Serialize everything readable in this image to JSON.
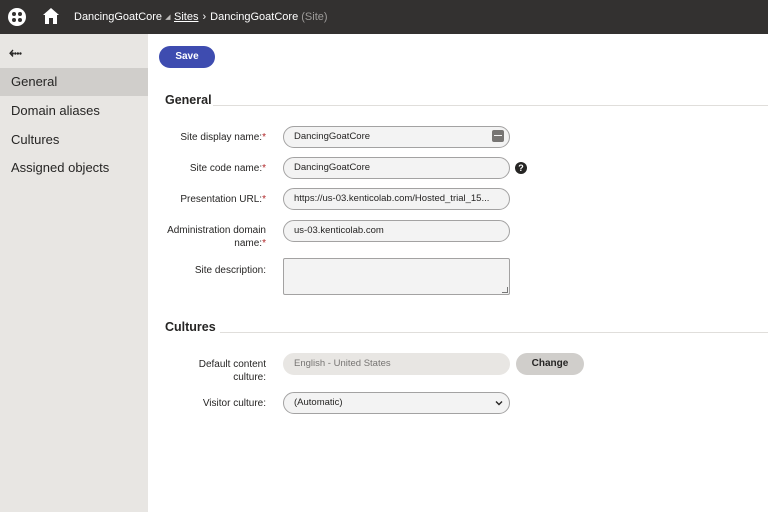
{
  "header": {
    "site_selector": "DancingGoatCore",
    "breadcrumb": {
      "root": "Sites",
      "current": "DancingGoatCore",
      "suffix": "(Site)"
    }
  },
  "sidebar": {
    "items": [
      {
        "label": "General",
        "active": true
      },
      {
        "label": "Domain aliases",
        "active": false
      },
      {
        "label": "Cultures",
        "active": false
      },
      {
        "label": "Assigned objects",
        "active": false
      }
    ]
  },
  "toolbar": {
    "save_label": "Save"
  },
  "general": {
    "title": "General",
    "site_display_name_label": "Site display name:",
    "site_display_name_value": "DancingGoatCore",
    "site_code_name_label": "Site code name:",
    "site_code_name_value": "DancingGoatCore",
    "presentation_url_label": "Presentation URL:",
    "presentation_url_value": "https://us-03.kenticolab.com/Hosted_trial_15...",
    "admin_domain_label_1": "Administration domain",
    "admin_domain_label_2": "name:",
    "admin_domain_value": "us-03.kenticolab.com",
    "site_description_label": "Site description:",
    "site_description_value": ""
  },
  "cultures": {
    "title": "Cultures",
    "default_content_culture_label_1": "Default content",
    "default_content_culture_label_2": "culture:",
    "default_content_culture_value": "English - United States",
    "change_label": "Change",
    "visitor_culture_label": "Visitor culture:",
    "visitor_culture_value": "(Automatic)"
  },
  "icons": {
    "logo": "kentico-logo-icon",
    "home": "home-icon",
    "back": "back-arrow-icon",
    "macro": "macro-editor-icon",
    "help": "help-icon",
    "dropdown": "chevron-down-icon"
  },
  "colors": {
    "topbar": "#333130",
    "sidebar": "#e8e6e3",
    "sidebar_active": "#d0cecb",
    "primary_button": "#3e4cb0",
    "required": "#b12628"
  }
}
